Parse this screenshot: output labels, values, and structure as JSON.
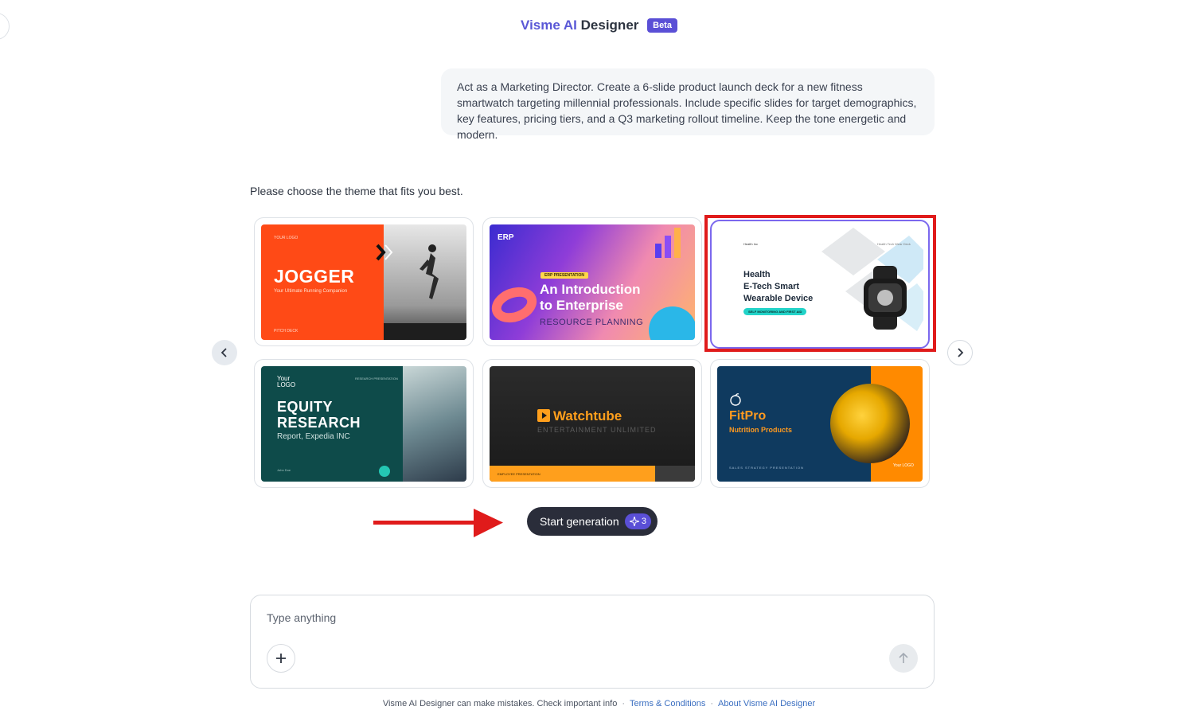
{
  "header": {
    "title_part1": "Visme AI",
    "title_part2": "Designer",
    "badge": "Beta"
  },
  "prompt": {
    "text": "Act as a Marketing Director. Create a 6-slide product launch deck for a new fitness smartwatch targeting millennial professionals. Include specific slides for target demographics, key features, pricing tiers, and a Q3 marketing rollout timeline. Keep the tone energetic and modern."
  },
  "theme_picker": {
    "instruction": "Please choose the theme that fits you best.",
    "themes": [
      {
        "name": "jogger",
        "title": "JOGGER",
        "subtitle": "Your Ultimate Running Companion",
        "tiny": "YOUR LOGO",
        "footer": "PITCH DECK",
        "selected": false
      },
      {
        "name": "erp",
        "logo": "ERP",
        "tag": "ERP PRESENTATION",
        "title_line1": "An Introduction",
        "title_line2": "to Enterprise",
        "subtitle": "RESOURCE PLANNING",
        "selected": false
      },
      {
        "name": "health",
        "brand": "Health Inc",
        "right_text": "Health Tech Wear Deck",
        "title_line1": "Health",
        "title_line2": "E-Tech Smart",
        "title_line3": "Wearable Device",
        "pill": "SELF MONITORING AND FIRST AID",
        "selected": true
      },
      {
        "name": "equity",
        "logo_line1": "Your",
        "logo_line2": "LOGO",
        "tiny": "RESEARCH PRESENTATION",
        "title_line1": "EQUITY",
        "title_line2": "RESEARCH",
        "subtitle": "Report, Expedia INC",
        "footer": "John Doe",
        "selected": false
      },
      {
        "name": "watchtube",
        "title": "Watchtube",
        "subtitle": "ENTERTAINMENT UNLIMITED",
        "footer": "EMPLOYEE PRESENTATION",
        "selected": false
      },
      {
        "name": "fitpro",
        "title": "FitPro",
        "subtitle": "Nutrition Products",
        "footer": "SALES STRATEGY PRESENTATION",
        "logo": "Your LOGO",
        "selected": false
      }
    ]
  },
  "actions": {
    "start_label": "Start generation",
    "start_credits": "3"
  },
  "composer": {
    "placeholder": "Type anything"
  },
  "footer": {
    "disclaimer": "Visme AI Designer can make mistakes. Check important info",
    "terms": "Terms & Conditions",
    "about": "About Visme AI Designer"
  },
  "colors": {
    "accent": "#5a4fd6",
    "annotation_red": "#e01b1b",
    "button_dark": "#2a2d3a"
  }
}
